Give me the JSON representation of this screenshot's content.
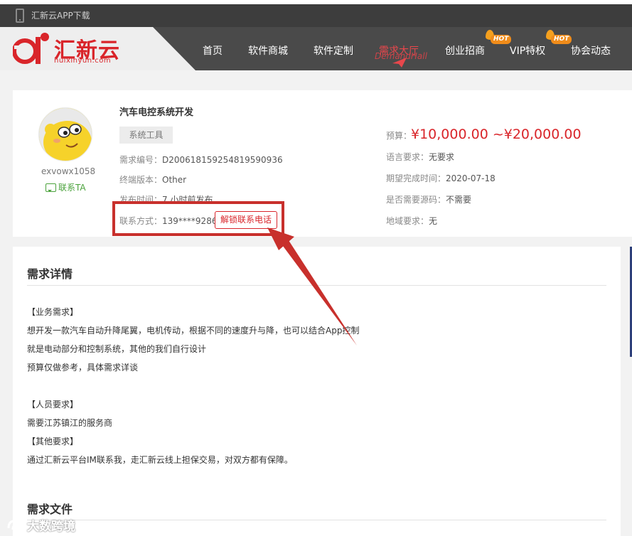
{
  "topbar": {
    "app_download": "汇新云APP下载",
    "icon": "phone-icon"
  },
  "logo": {
    "name": "汇新云",
    "domain": "huixinyun.com"
  },
  "nav": {
    "items": [
      {
        "label": "首页"
      },
      {
        "label": "软件商城"
      },
      {
        "label": "软件定制"
      },
      {
        "label": "需求大厅",
        "sub": "DemandHall",
        "active": true
      },
      {
        "label": "创业招商",
        "badge": "HOT"
      },
      {
        "label": "VIP特权",
        "badge": "HOT"
      },
      {
        "label": "协会动态"
      }
    ]
  },
  "user": {
    "name": "exvowx1058",
    "contact": "联系TA"
  },
  "project": {
    "title": "汽车电控系统开发",
    "tag": "系统工具",
    "id_label": "需求编号：",
    "id_value": "D200618159254819590936",
    "terminal_label": "终端版本：",
    "terminal_value": "Other",
    "publish_label": "发布时间：",
    "publish_value": "7 小时前发布",
    "contact_label": "联系方式：",
    "contact_value": "139****9286",
    "unlock_button": "解锁联系电话",
    "budget_label": "预算：",
    "budget_value": "¥10,000.00 ~¥20,000.00",
    "language_label": "语言要求：",
    "language_value": "无要求",
    "deadline_label": "期望完成时间：",
    "deadline_value": "2020-07-18",
    "source_label": "是否需要源码：",
    "source_value": "不需要",
    "region_label": "地域要求：",
    "region_value": "无"
  },
  "detail": {
    "title": "需求详情",
    "lines": [
      "【业务需求】",
      "想开发一款汽车自动升降尾翼，电机传动，根据不同的速度升与降，也可以结合App控制",
      "就是电动部分和控制系统，其他的我们自行设计",
      "预算仅做参考，具体需求详谈",
      "【人员要求】",
      "需要江苏镇江的服务商",
      "【其他要求】",
      "通过汇新云平台IM联系我，走汇新云线上担保交易，对双方都有保障。"
    ],
    "files_title": "需求文件"
  },
  "watermark": "大数跨境",
  "colors": {
    "accent": "#d9252a",
    "nav_bg": "#4a4a4a",
    "highlight_box": "#c8302c"
  }
}
